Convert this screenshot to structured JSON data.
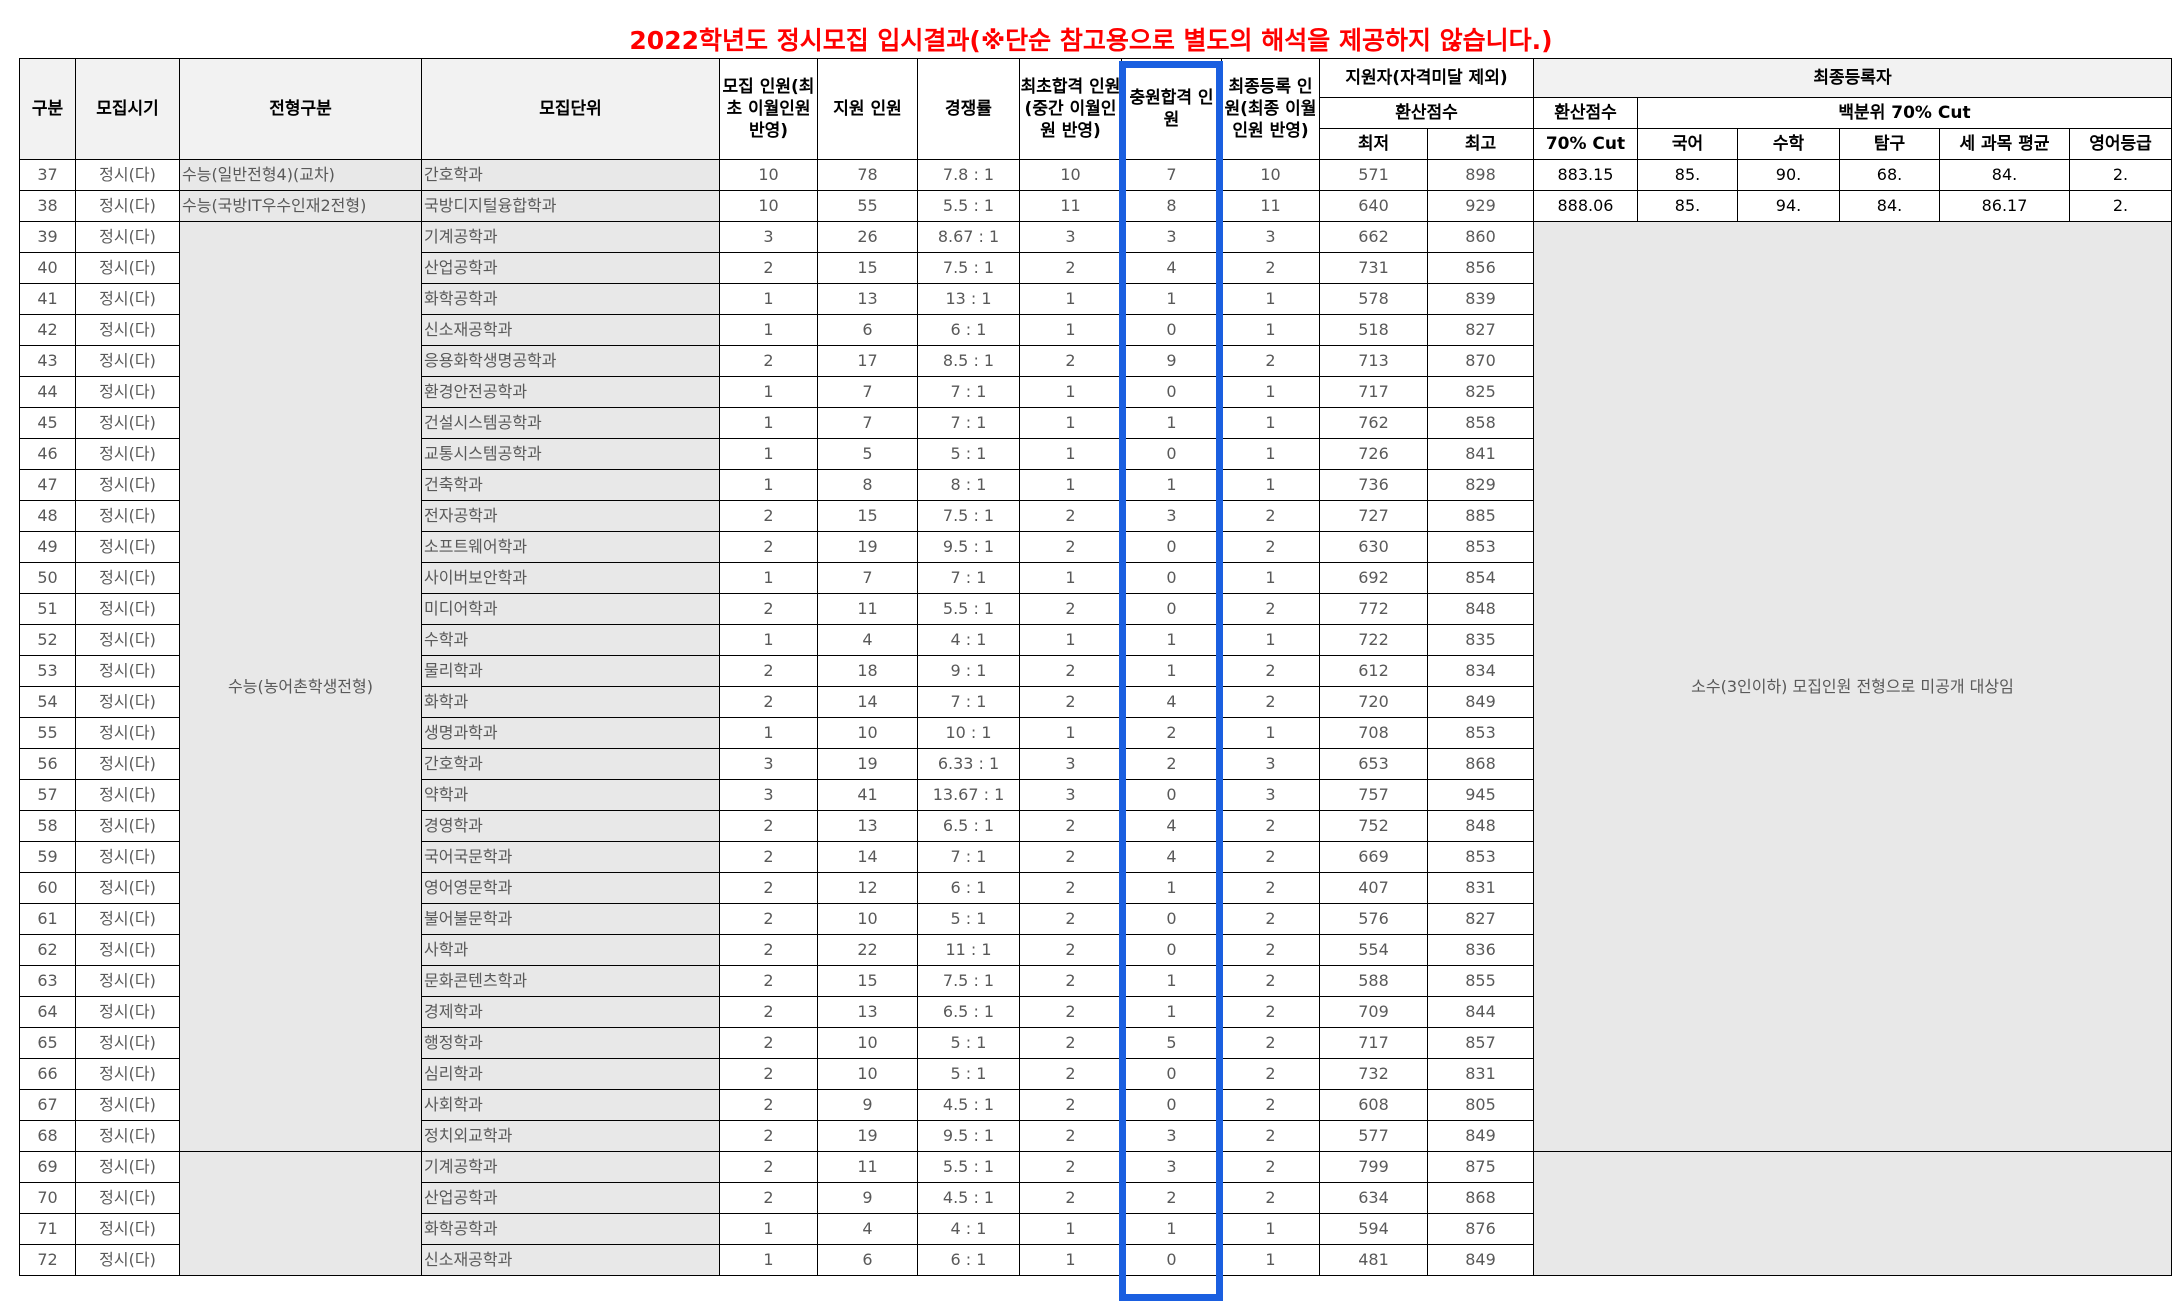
{
  "title": "2022학년도 정시모집 입시결과(※단순 참고용으로 별도의 해석을 제공하지 않습니다.)",
  "colors": {
    "title": "#ff0000",
    "highlight": "#1a5fe0"
  },
  "headers": {
    "gubun": "구분",
    "period": "모집시기",
    "type": "전형구분",
    "unit": "모집단위",
    "quota": "모집 인원(최초 이월인원 반영)",
    "applicants": "지원 인원",
    "ratio": "경쟁률",
    "first_pass": "최초합격 인원(중간 이월인원 반영)",
    "extra_pass": "충원합격 인원",
    "final_reg": "최종등록 인원(최종 이월인원 반영)",
    "applicant_group": "지원자(자격미달 제외)",
    "score_group": "환산점수",
    "min": "최저",
    "max": "최고",
    "final_group": "최종등록자",
    "final_score": "환산점수",
    "final_score_cut": "70% Cut",
    "percentile_group": "백분위 70% Cut",
    "korean": "국어",
    "math": "수학",
    "inquiry": "탐구",
    "three_avg": "세 과목 평균",
    "english": "영어등급"
  },
  "merged": {
    "nongeochon": "수능(농어촌학생전형)",
    "undisclosed": "소수(3인이하) 모집인원 전형으로 미공개 대상임"
  },
  "rows_top": [
    {
      "no": "37",
      "period": "정시(다)",
      "type": "수능(일반전형4)(교차)",
      "unit": "간호학과",
      "quota": "10",
      "app": "78",
      "ratio": "7.8 : 1",
      "first": "10",
      "extra": "7",
      "final": "10",
      "min": "571",
      "max": "898",
      "cut": "883.15",
      "kor": "85.",
      "math": "90.",
      "inq": "68.",
      "avg": "84.",
      "eng": "2."
    },
    {
      "no": "38",
      "period": "정시(다)",
      "type": "수능(국방IT우수인재2전형)",
      "unit": "국방디지털융합학과",
      "quota": "10",
      "app": "55",
      "ratio": "5.5 : 1",
      "first": "11",
      "extra": "8",
      "final": "11",
      "min": "640",
      "max": "929",
      "cut": "888.06",
      "kor": "85.",
      "math": "94.",
      "inq": "84.",
      "avg": "86.17",
      "eng": "2."
    }
  ],
  "rows_mid": [
    {
      "no": "39",
      "period": "정시(다)",
      "unit": "기계공학과",
      "quota": "3",
      "app": "26",
      "ratio": "8.67 : 1",
      "first": "3",
      "extra": "3",
      "final": "3",
      "min": "662",
      "max": "860"
    },
    {
      "no": "40",
      "period": "정시(다)",
      "unit": "산업공학과",
      "quota": "2",
      "app": "15",
      "ratio": "7.5 : 1",
      "first": "2",
      "extra": "4",
      "final": "2",
      "min": "731",
      "max": "856"
    },
    {
      "no": "41",
      "period": "정시(다)",
      "unit": "화학공학과",
      "quota": "1",
      "app": "13",
      "ratio": "13 : 1",
      "first": "1",
      "extra": "1",
      "final": "1",
      "min": "578",
      "max": "839"
    },
    {
      "no": "42",
      "period": "정시(다)",
      "unit": "신소재공학과",
      "quota": "1",
      "app": "6",
      "ratio": "6 : 1",
      "first": "1",
      "extra": "0",
      "final": "1",
      "min": "518",
      "max": "827"
    },
    {
      "no": "43",
      "period": "정시(다)",
      "unit": "응용화학생명공학과",
      "quota": "2",
      "app": "17",
      "ratio": "8.5 : 1",
      "first": "2",
      "extra": "9",
      "final": "2",
      "min": "713",
      "max": "870"
    },
    {
      "no": "44",
      "period": "정시(다)",
      "unit": "환경안전공학과",
      "quota": "1",
      "app": "7",
      "ratio": "7 : 1",
      "first": "1",
      "extra": "0",
      "final": "1",
      "min": "717",
      "max": "825"
    },
    {
      "no": "45",
      "period": "정시(다)",
      "unit": "건설시스템공학과",
      "quota": "1",
      "app": "7",
      "ratio": "7 : 1",
      "first": "1",
      "extra": "1",
      "final": "1",
      "min": "762",
      "max": "858"
    },
    {
      "no": "46",
      "period": "정시(다)",
      "unit": "교통시스템공학과",
      "quota": "1",
      "app": "5",
      "ratio": "5 : 1",
      "first": "1",
      "extra": "0",
      "final": "1",
      "min": "726",
      "max": "841"
    },
    {
      "no": "47",
      "period": "정시(다)",
      "unit": "건축학과",
      "quota": "1",
      "app": "8",
      "ratio": "8 : 1",
      "first": "1",
      "extra": "1",
      "final": "1",
      "min": "736",
      "max": "829"
    },
    {
      "no": "48",
      "period": "정시(다)",
      "unit": "전자공학과",
      "quota": "2",
      "app": "15",
      "ratio": "7.5 : 1",
      "first": "2",
      "extra": "3",
      "final": "2",
      "min": "727",
      "max": "885"
    },
    {
      "no": "49",
      "period": "정시(다)",
      "unit": "소프트웨어학과",
      "quota": "2",
      "app": "19",
      "ratio": "9.5 : 1",
      "first": "2",
      "extra": "0",
      "final": "2",
      "min": "630",
      "max": "853"
    },
    {
      "no": "50",
      "period": "정시(다)",
      "unit": "사이버보안학과",
      "quota": "1",
      "app": "7",
      "ratio": "7 : 1",
      "first": "1",
      "extra": "0",
      "final": "1",
      "min": "692",
      "max": "854"
    },
    {
      "no": "51",
      "period": "정시(다)",
      "unit": "미디어학과",
      "quota": "2",
      "app": "11",
      "ratio": "5.5 : 1",
      "first": "2",
      "extra": "0",
      "final": "2",
      "min": "772",
      "max": "848"
    },
    {
      "no": "52",
      "period": "정시(다)",
      "unit": "수학과",
      "quota": "1",
      "app": "4",
      "ratio": "4 : 1",
      "first": "1",
      "extra": "1",
      "final": "1",
      "min": "722",
      "max": "835"
    },
    {
      "no": "53",
      "period": "정시(다)",
      "unit": "물리학과",
      "quota": "2",
      "app": "18",
      "ratio": "9 : 1",
      "first": "2",
      "extra": "1",
      "final": "2",
      "min": "612",
      "max": "834"
    },
    {
      "no": "54",
      "period": "정시(다)",
      "unit": "화학과",
      "quota": "2",
      "app": "14",
      "ratio": "7 : 1",
      "first": "2",
      "extra": "4",
      "final": "2",
      "min": "720",
      "max": "849"
    },
    {
      "no": "55",
      "period": "정시(다)",
      "unit": "생명과학과",
      "quota": "1",
      "app": "10",
      "ratio": "10 : 1",
      "first": "1",
      "extra": "2",
      "final": "1",
      "min": "708",
      "max": "853"
    },
    {
      "no": "56",
      "period": "정시(다)",
      "unit": "간호학과",
      "quota": "3",
      "app": "19",
      "ratio": "6.33 : 1",
      "first": "3",
      "extra": "2",
      "final": "3",
      "min": "653",
      "max": "868"
    },
    {
      "no": "57",
      "period": "정시(다)",
      "unit": "약학과",
      "quota": "3",
      "app": "41",
      "ratio": "13.67 : 1",
      "first": "3",
      "extra": "0",
      "final": "3",
      "min": "757",
      "max": "945"
    },
    {
      "no": "58",
      "period": "정시(다)",
      "unit": "경영학과",
      "quota": "2",
      "app": "13",
      "ratio": "6.5 : 1",
      "first": "2",
      "extra": "4",
      "final": "2",
      "min": "752",
      "max": "848"
    },
    {
      "no": "59",
      "period": "정시(다)",
      "unit": "국어국문학과",
      "quota": "2",
      "app": "14",
      "ratio": "7 : 1",
      "first": "2",
      "extra": "4",
      "final": "2",
      "min": "669",
      "max": "853"
    },
    {
      "no": "60",
      "period": "정시(다)",
      "unit": "영어영문학과",
      "quota": "2",
      "app": "12",
      "ratio": "6 : 1",
      "first": "2",
      "extra": "1",
      "final": "2",
      "min": "407",
      "max": "831"
    },
    {
      "no": "61",
      "period": "정시(다)",
      "unit": "불어불문학과",
      "quota": "2",
      "app": "10",
      "ratio": "5 : 1",
      "first": "2",
      "extra": "0",
      "final": "2",
      "min": "576",
      "max": "827"
    },
    {
      "no": "62",
      "period": "정시(다)",
      "unit": "사학과",
      "quota": "2",
      "app": "22",
      "ratio": "11 : 1",
      "first": "2",
      "extra": "0",
      "final": "2",
      "min": "554",
      "max": "836"
    },
    {
      "no": "63",
      "period": "정시(다)",
      "unit": "문화콘텐츠학과",
      "quota": "2",
      "app": "15",
      "ratio": "7.5 : 1",
      "first": "2",
      "extra": "1",
      "final": "2",
      "min": "588",
      "max": "855"
    },
    {
      "no": "64",
      "period": "정시(다)",
      "unit": "경제학과",
      "quota": "2",
      "app": "13",
      "ratio": "6.5 : 1",
      "first": "2",
      "extra": "1",
      "final": "2",
      "min": "709",
      "max": "844"
    },
    {
      "no": "65",
      "period": "정시(다)",
      "unit": "행정학과",
      "quota": "2",
      "app": "10",
      "ratio": "5 : 1",
      "first": "2",
      "extra": "5",
      "final": "2",
      "min": "717",
      "max": "857"
    },
    {
      "no": "66",
      "period": "정시(다)",
      "unit": "심리학과",
      "quota": "2",
      "app": "10",
      "ratio": "5 : 1",
      "first": "2",
      "extra": "0",
      "final": "2",
      "min": "732",
      "max": "831"
    },
    {
      "no": "67",
      "period": "정시(다)",
      "unit": "사회학과",
      "quota": "2",
      "app": "9",
      "ratio": "4.5 : 1",
      "first": "2",
      "extra": "0",
      "final": "2",
      "min": "608",
      "max": "805"
    },
    {
      "no": "68",
      "period": "정시(다)",
      "unit": "정치외교학과",
      "quota": "2",
      "app": "19",
      "ratio": "9.5 : 1",
      "first": "2",
      "extra": "3",
      "final": "2",
      "min": "577",
      "max": "849"
    }
  ],
  "rows_bot": [
    {
      "no": "69",
      "period": "정시(다)",
      "unit": "기계공학과",
      "quota": "2",
      "app": "11",
      "ratio": "5.5 : 1",
      "first": "2",
      "extra": "3",
      "final": "2",
      "min": "799",
      "max": "875"
    },
    {
      "no": "70",
      "period": "정시(다)",
      "unit": "산업공학과",
      "quota": "2",
      "app": "9",
      "ratio": "4.5 : 1",
      "first": "2",
      "extra": "2",
      "final": "2",
      "min": "634",
      "max": "868"
    },
    {
      "no": "71",
      "period": "정시(다)",
      "unit": "화학공학과",
      "quota": "1",
      "app": "4",
      "ratio": "4 : 1",
      "first": "1",
      "extra": "1",
      "final": "1",
      "min": "594",
      "max": "876"
    },
    {
      "no": "72",
      "period": "정시(다)",
      "unit": "신소재공학과",
      "quota": "1",
      "app": "6",
      "ratio": "6 : 1",
      "first": "1",
      "extra": "0",
      "final": "1",
      "min": "481",
      "max": "849"
    }
  ]
}
